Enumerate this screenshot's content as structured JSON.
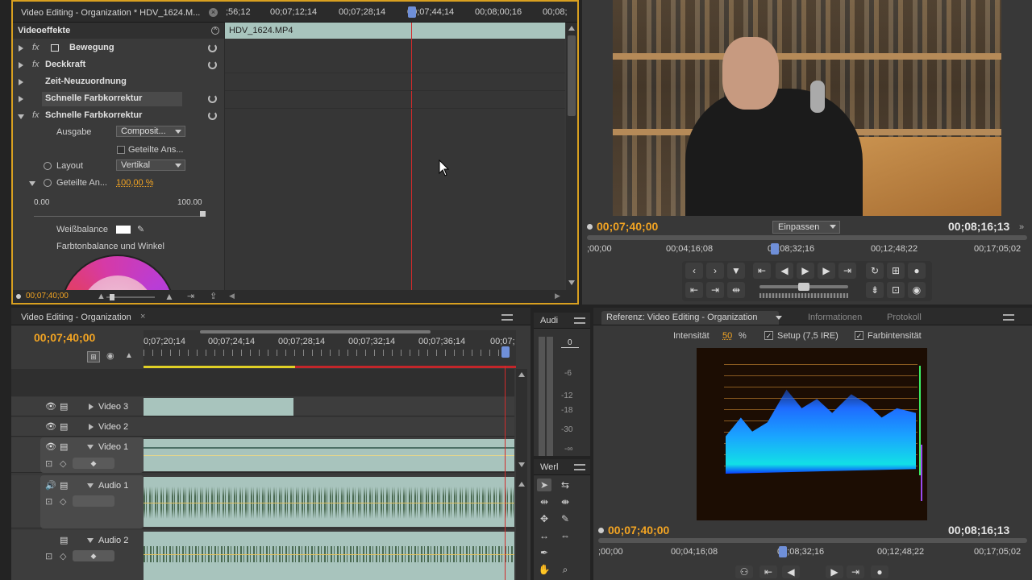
{
  "effect_controls": {
    "tab_title": "Video Editing - Organization * HDV_1624.M...",
    "ruler_ticks": [
      ";56;12",
      "00;07;12;14",
      "00;07;28;14",
      "00;07;44;14",
      "00;08;00;16",
      "00;08;"
    ],
    "heading": "Videoeffekte",
    "clip_name": "HDV_1624.MP4",
    "effects": [
      {
        "label": "Bewegung"
      },
      {
        "label": "Deckkraft"
      },
      {
        "label": "Zeit-Neuzuordnung"
      },
      {
        "label": "Schnelle Farbkorrektur"
      },
      {
        "label": "Schnelle Farbkorrektur"
      }
    ],
    "params": {
      "ausgabe_label": "Ausgabe",
      "ausgabe_value": "Composit...",
      "geteilte_check": "Geteilte Ans...",
      "layout_label": "Layout",
      "layout_value": "Vertikal",
      "geteilte_an_label": "Geteilte An...",
      "geteilte_an_value": "100,00 %",
      "slider_min": "0.00",
      "slider_max": "100.00",
      "weiss_label": "Weißbalance",
      "farbton_label": "Farbtonbalance und Winkel"
    },
    "footer_timecode": "00;07;40;00"
  },
  "program_monitor": {
    "current_time": "00;07;40;00",
    "zoom": "Einpassen",
    "duration": "00;08;16;13",
    "ticks": [
      ";00;00",
      "00;04;16;08",
      "00;08;32;16",
      "00;12;48;22",
      "00;17;05;02"
    ]
  },
  "timeline": {
    "tab_title": "Video Editing - Organization",
    "timecode": "00;07;40;00",
    "ticks": [
      "0;07;20;14",
      "00;07;24;14",
      "00;07;28;14",
      "00;07;32;14",
      "00;07;36;14",
      "00;07;"
    ],
    "tracks": [
      {
        "name": "Video 3"
      },
      {
        "name": "Video 2"
      },
      {
        "name": "Video 1"
      },
      {
        "name": "Audio 1"
      },
      {
        "name": "Audio 2"
      }
    ]
  },
  "audio_meter": {
    "tab": "Audi",
    "scale": [
      "0",
      "-6",
      "-12",
      "-18",
      "-30",
      "-∞"
    ]
  },
  "tools": {
    "tab": "Werl"
  },
  "reference_monitor": {
    "tab_title": "Referenz: Video Editing - Organization",
    "tab_info": "Informationen",
    "tab_protokoll": "Protokoll",
    "intensity_label": "Intensität",
    "intensity_value": "50",
    "percent": "%",
    "setup_label": "Setup (7,5 IRE)",
    "chroma_label": "Farbintensität",
    "current_time": "00;07;40;00",
    "duration": "00;08;16;13",
    "ticks": [
      ";00;00",
      "00;04;16;08",
      "00;08;32;16",
      "00;12;48;22",
      "00;17;05;02"
    ]
  },
  "colors": {
    "accent": "#f2a423",
    "playhead": "#d22b2b",
    "clip": "#a8c4bd"
  }
}
